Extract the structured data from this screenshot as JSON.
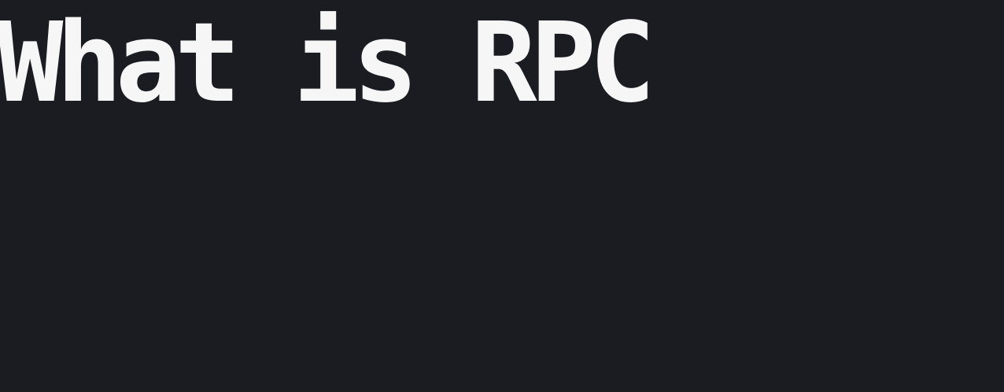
{
  "slide": {
    "title": "What is RPC"
  },
  "colors": {
    "background": "#1b1c21",
    "title_text": "#f6f6f7"
  }
}
